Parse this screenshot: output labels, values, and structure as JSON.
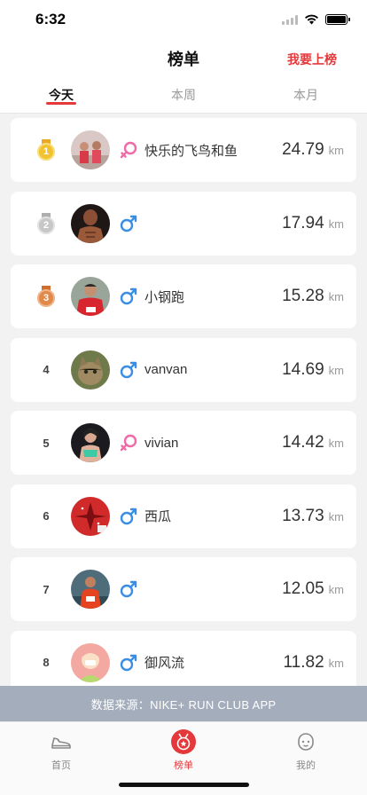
{
  "status": {
    "time": "6:32"
  },
  "nav": {
    "title": "榜单",
    "action": "我要上榜"
  },
  "tabs": [
    {
      "label": "今天",
      "active": true
    },
    {
      "label": "本周",
      "active": false
    },
    {
      "label": "本月",
      "active": false
    }
  ],
  "unit": "km",
  "rows": [
    {
      "rank": "1",
      "medal": "gold",
      "gender": "female",
      "name": "快乐的飞鸟和鱼",
      "distance": "24.79"
    },
    {
      "rank": "2",
      "medal": "silver",
      "gender": "male",
      "name": "",
      "distance": "17.94"
    },
    {
      "rank": "3",
      "medal": "bronze",
      "gender": "male",
      "name": "小钢跑",
      "distance": "15.28"
    },
    {
      "rank": "4",
      "medal": "",
      "gender": "male",
      "name": "vanvan",
      "distance": "14.69"
    },
    {
      "rank": "5",
      "medal": "",
      "gender": "female",
      "name": "vivian",
      "distance": "14.42"
    },
    {
      "rank": "6",
      "medal": "",
      "gender": "male",
      "name": "西瓜",
      "distance": "13.73"
    },
    {
      "rank": "7",
      "medal": "",
      "gender": "male",
      "name": "",
      "distance": "12.05"
    },
    {
      "rank": "8",
      "medal": "",
      "gender": "male",
      "name": "御风流",
      "distance": "11.82"
    }
  ],
  "source": "数据来源：NIKE+ RUN CLUB APP",
  "tabbar": [
    {
      "label": "首页",
      "icon": "shoe-icon",
      "active": false
    },
    {
      "label": "榜单",
      "icon": "medal-icon",
      "active": true
    },
    {
      "label": "我的",
      "icon": "face-icon",
      "active": false
    }
  ],
  "colors": {
    "accent": "#e5383b",
    "male": "#3a8ee6",
    "female": "#f06aa8",
    "source_bar": "#a4adbc"
  }
}
